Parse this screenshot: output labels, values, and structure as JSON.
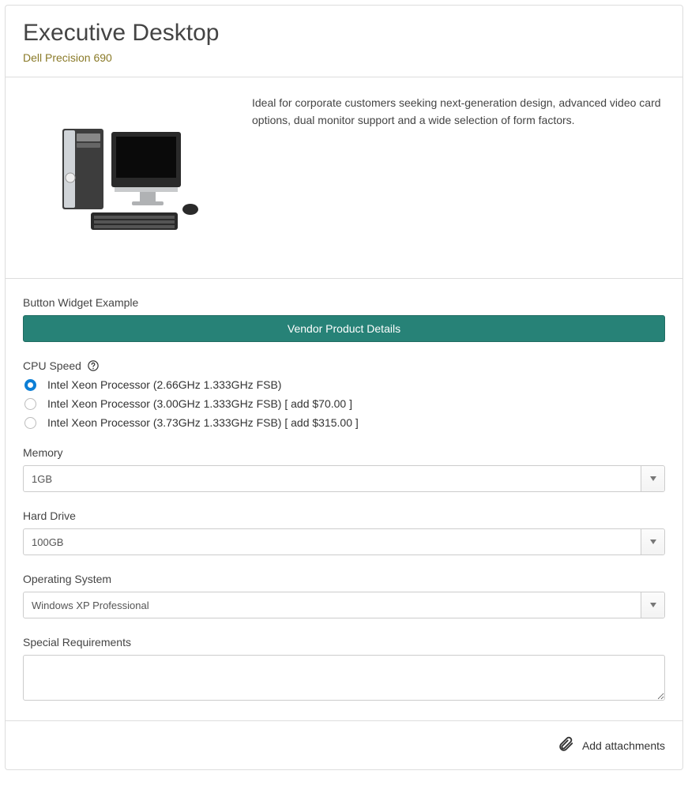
{
  "header": {
    "title": "Executive Desktop",
    "subtitle": "Dell Precision 690"
  },
  "description": "Ideal for corporate customers seeking next-generation design, advanced video card options, dual monitor support and a wide selection of form factors.",
  "button_example_label": "Button Widget Example",
  "vendor_button": "Vendor Product Details",
  "cpu": {
    "label": "CPU Speed",
    "options": [
      {
        "label": "Intel Xeon Processor (2.66GHz 1.333GHz FSB)",
        "selected": true
      },
      {
        "label": "Intel Xeon Processor (3.00GHz 1.333GHz FSB) [ add $70.00 ]",
        "selected": false
      },
      {
        "label": "Intel Xeon Processor (3.73GHz 1.333GHz FSB) [ add $315.00 ]",
        "selected": false
      }
    ]
  },
  "memory": {
    "label": "Memory",
    "value": "1GB"
  },
  "hard_drive": {
    "label": "Hard Drive",
    "value": "100GB"
  },
  "os": {
    "label": "Operating System",
    "value": "Windows XP Professional"
  },
  "special": {
    "label": "Special Requirements",
    "value": ""
  },
  "footer": {
    "add_attachments": "Add attachments"
  }
}
